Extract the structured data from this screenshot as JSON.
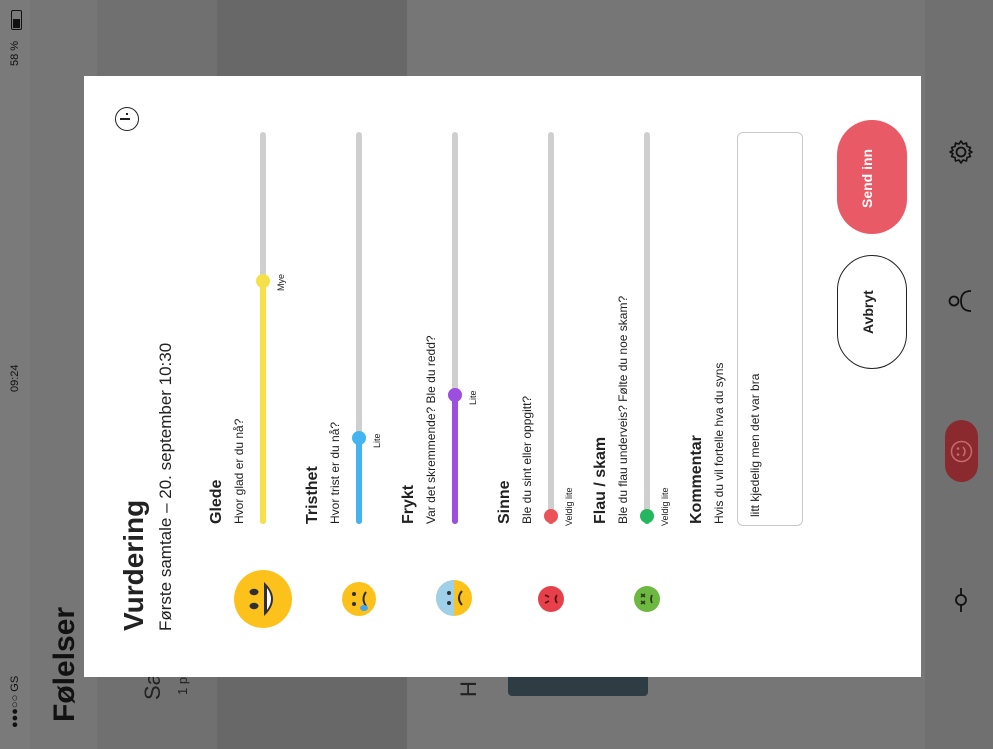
{
  "status": {
    "carrier": "●●●○○ GS",
    "time": "09:24",
    "battery": "58 %"
  },
  "app": {
    "title": "Følelser",
    "peek_text_1": "Sa",
    "peek_text_2": "1 p",
    "peek_text_3": "H"
  },
  "modal": {
    "title": "Vurdering",
    "subtitle": "Første samtale – 20. september 10:30",
    "info_icon": "info-icon",
    "emotions": [
      {
        "title": "Glede",
        "question": "Hvor glad er du nå?",
        "value_label": "Mye",
        "color": "#f5e04a",
        "level": 0.62
      },
      {
        "title": "Tristhet",
        "question": "Hvor trist er du nå?",
        "value_label": "Lite",
        "color": "#43b4ef",
        "level": 0.22
      },
      {
        "title": "Frykt",
        "question": "Var det skremmende? Ble du redd?",
        "value_label": "Lite",
        "color": "#9b4ee0",
        "level": 0.33
      },
      {
        "title": "Sinne",
        "question": "Ble du sint eller oppgitt?",
        "value_label": "Veldig lite",
        "color": "#ea5458",
        "level": 0.02
      },
      {
        "title": "Flau / skam",
        "question": "Ble du flau underveis? Følte du noe skam?",
        "value_label": "Veldig lite",
        "color": "#25b65f",
        "level": 0.02
      }
    ],
    "comment": {
      "title": "Kommentar",
      "subtitle": "Hvis du vil fortelle hva du syns",
      "value": "litt kjedelig men det var bra"
    },
    "cancel_label": "Avbryt",
    "submit_label": "Send inn",
    "submit_color": "#e85a66"
  },
  "sidebar": {
    "icons": [
      "gear-icon",
      "person-icon",
      "emotion-icon",
      "timeline-icon"
    ]
  }
}
